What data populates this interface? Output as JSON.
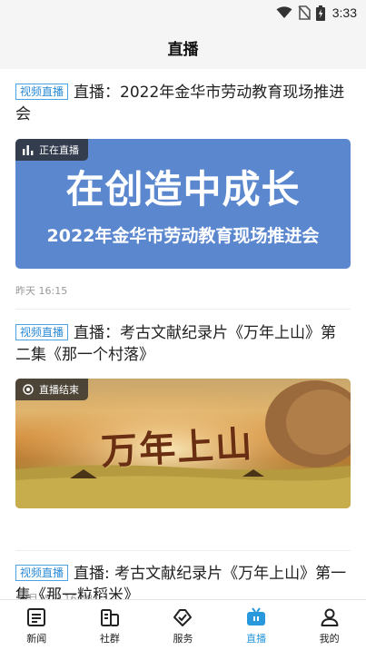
{
  "status_bar": {
    "time": "3:33"
  },
  "header": {
    "title": "直播"
  },
  "feed": {
    "items": [
      {
        "tag": "视频直播",
        "title": "直播：2022年金华市劳动教育现场推进会",
        "badge": "正在直播",
        "thumb_main_text": "在创造中成长",
        "thumb_sub_text": "2022年金华市劳动教育现场推进会",
        "time": "昨天 16:15"
      },
      {
        "tag": "视频直播",
        "title": "直播：考古文献纪录片《万年上山》第二集《那一个村落》",
        "badge": "直播结束",
        "thumb_art_text": "万年上山",
        "time": "10月25日 16:48"
      },
      {
        "tag": "视频直播",
        "title": "直播: 考古文献纪录片《万年上山》第一集《那一粒稻米》"
      }
    ]
  },
  "tabbar": {
    "items": [
      {
        "label": "新闻",
        "icon": "news-icon"
      },
      {
        "label": "社群",
        "icon": "community-icon"
      },
      {
        "label": "服务",
        "icon": "service-icon"
      },
      {
        "label": "直播",
        "icon": "live-tv-icon"
      },
      {
        "label": "我的",
        "icon": "profile-icon"
      }
    ],
    "active": "直播",
    "accent_color": "#2a98dc"
  },
  "colors": {
    "tag": "#2a8ad6",
    "thumb_blue": "#5b87cf"
  }
}
